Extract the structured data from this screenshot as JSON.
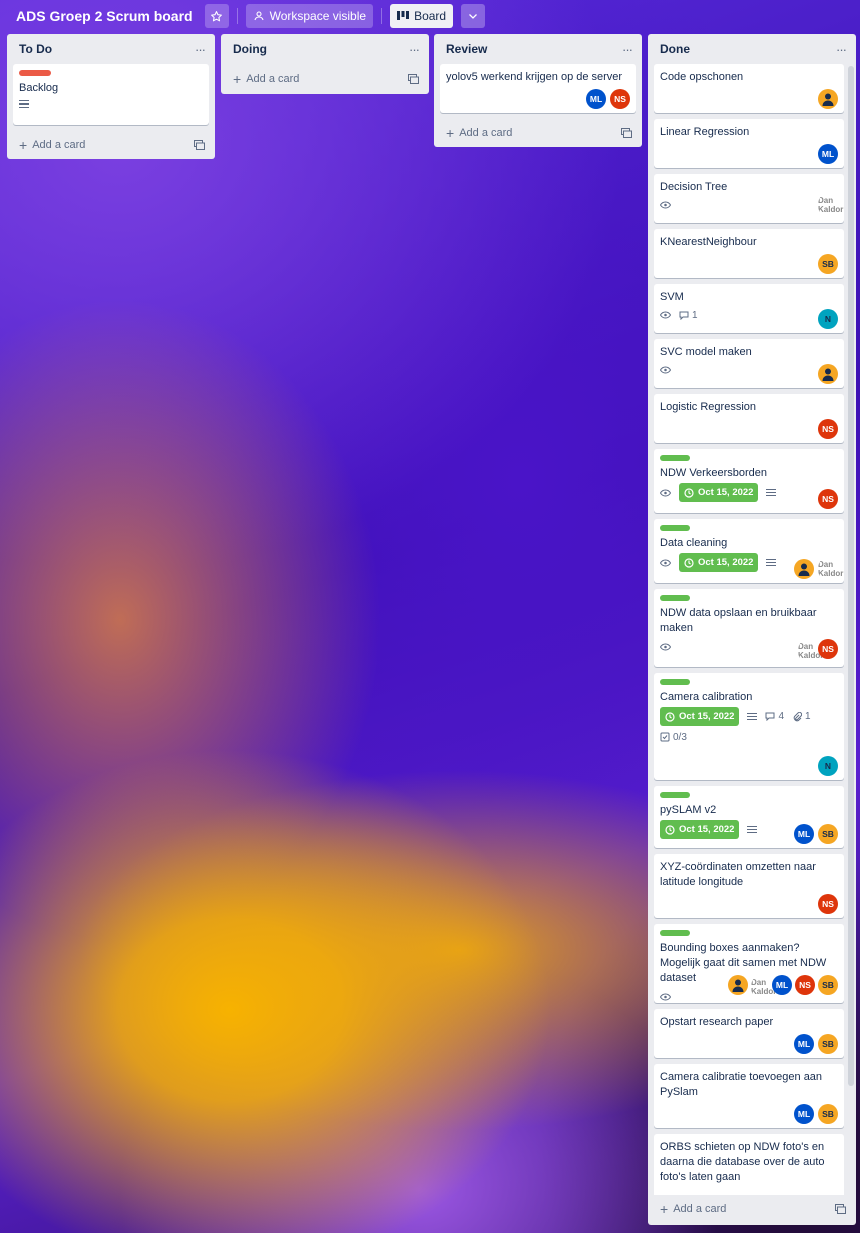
{
  "topbar": {
    "board_title": "ADS Groep 2 Scrum board",
    "visibility_label": "Workspace visible",
    "view_label": "Board"
  },
  "common": {
    "add_card": "Add a card",
    "menu": "···"
  },
  "colors": {
    "green_label": "#61bd4f",
    "red_label": "#eb5a46"
  },
  "lists": {
    "todo": {
      "title": "To Do",
      "card1": {
        "title": "Backlog"
      }
    },
    "doing": {
      "title": "Doing"
    },
    "review": {
      "title": "Review",
      "card1": {
        "title": "yolov5 werkend krijgen op de server"
      }
    },
    "done": {
      "title": "Done",
      "cards": {
        "c1": {
          "title": "Code opschonen"
        },
        "c2": {
          "title": "Linear Regression"
        },
        "c3": {
          "title": "Decision Tree"
        },
        "c4": {
          "title": "KNearestNeighbour"
        },
        "c5": {
          "title": "SVM",
          "comments": "1"
        },
        "c6": {
          "title": "SVC model maken"
        },
        "c7": {
          "title": "Logistic Regression"
        },
        "c8": {
          "title": "NDW Verkeersborden",
          "due": "Oct 15, 2022"
        },
        "c9": {
          "title": "Data cleaning",
          "due": "Oct 15, 2022"
        },
        "c10": {
          "title": "NDW data opslaan en bruikbaar maken"
        },
        "c11": {
          "title": "Camera calibration",
          "due": "Oct 15, 2022",
          "comments": "4",
          "attachments": "1",
          "checklist": "0/3"
        },
        "c12": {
          "title": "pySLAM v2",
          "due": "Oct 15, 2022"
        },
        "c13": {
          "title": "XYZ-coördinaten omzetten naar latitude longitude"
        },
        "c14": {
          "title": "Bounding boxes aanmaken? Mogelijk gaat dit samen met NDW dataset"
        },
        "c15": {
          "title": "Opstart research paper"
        },
        "c16": {
          "title": "Camera calibratie toevoegen aan PySlam"
        },
        "c17": {
          "title": "ORBS schieten op NDW foto's en daarna die database over de auto foto's laten gaan"
        }
      }
    }
  },
  "members": {
    "ML": "ML",
    "NS": "NS",
    "SB": "SB",
    "N": "N",
    "broken_alt": "Dan Kaldor"
  }
}
